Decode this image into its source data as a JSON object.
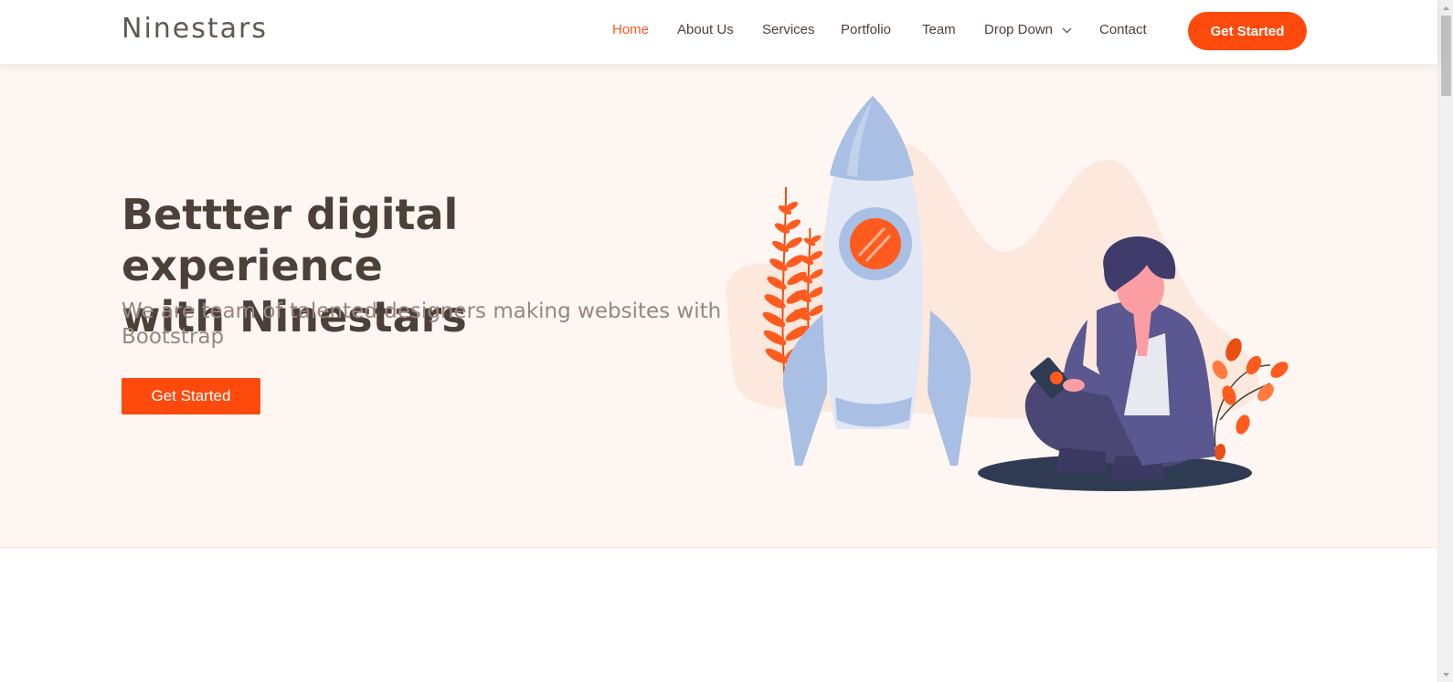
{
  "brand": {
    "name": "Ninestars",
    "accent": "#ff4a0d"
  },
  "nav": {
    "items": [
      {
        "label": "Home",
        "active": true
      },
      {
        "label": "About Us"
      },
      {
        "label": "Services"
      },
      {
        "label": "Portfolio"
      },
      {
        "label": "Team"
      },
      {
        "label": "Drop Down",
        "has_dropdown": true
      },
      {
        "label": "Contact"
      }
    ],
    "cta_label": "Get Started"
  },
  "hero": {
    "title_line1": "Bettter digital experience",
    "title_line2": "with Ninestars",
    "subtitle": "We are team of talented designers making websites with Bootstrap",
    "cta_label": "Get Started",
    "illustration": "rocket-and-person-illustration"
  }
}
